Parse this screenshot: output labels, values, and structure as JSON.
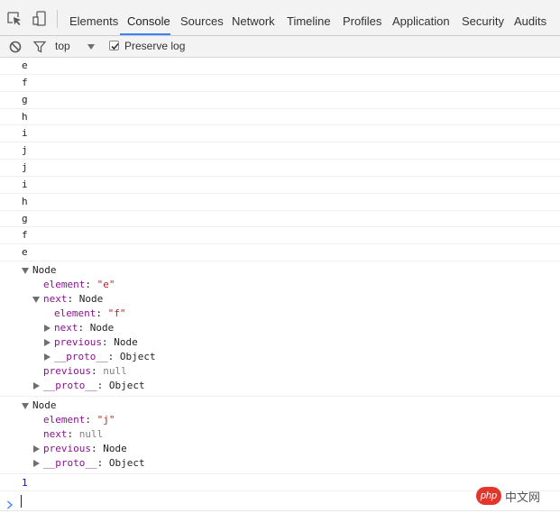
{
  "tabs": [
    {
      "label": "Elements",
      "active": false
    },
    {
      "label": "Console",
      "active": true
    },
    {
      "label": "Sources",
      "active": false
    },
    {
      "label": "Network",
      "active": false
    },
    {
      "label": "Timeline",
      "active": false
    },
    {
      "label": "Profiles",
      "active": false
    },
    {
      "label": "Application",
      "active": false
    },
    {
      "label": "Security",
      "active": false
    },
    {
      "label": "Audits",
      "active": false
    }
  ],
  "toolbar": {
    "icons": [
      "inspect-element-icon",
      "device-toolbar-icon",
      "clear-console-icon",
      "filter-icon"
    ],
    "context": "top",
    "preserve_log_label": "Preserve log",
    "preserve_log_checked": true
  },
  "logs": [
    "e",
    "f",
    "g",
    "h",
    "i",
    "j",
    "j",
    "i",
    "h",
    "g",
    "f",
    "e"
  ],
  "objects": [
    {
      "title": "Node",
      "element_key": "element",
      "element_value": "\"e\"",
      "next_key": "next",
      "next_type": "Node",
      "next_element_key": "element",
      "next_element_value": "\"f\"",
      "next_next_key": "next",
      "next_next_type": "Node",
      "next_previous_key": "previous",
      "next_previous_type": "Node",
      "next_proto_key": "__proto__",
      "next_proto_type": "Object",
      "previous_key": "previous",
      "previous_value": "null",
      "proto_key": "__proto__",
      "proto_type": "Object"
    },
    {
      "title": "Node",
      "element_key": "element",
      "element_value": "\"j\"",
      "next_key": "next",
      "next_value": "null",
      "previous_key": "previous",
      "previous_type": "Node",
      "proto_key": "__proto__",
      "proto_type": "Object"
    }
  ],
  "result": "1",
  "watermark": {
    "badge": "php",
    "text": "中文网"
  },
  "colors": {
    "active_tab_underline": "#3e82f7",
    "property_name": "#881391",
    "string_value": "#c41a16",
    "null_value": "#808080",
    "number_value": "#1c00cf",
    "prompt": "#3e82f7"
  }
}
